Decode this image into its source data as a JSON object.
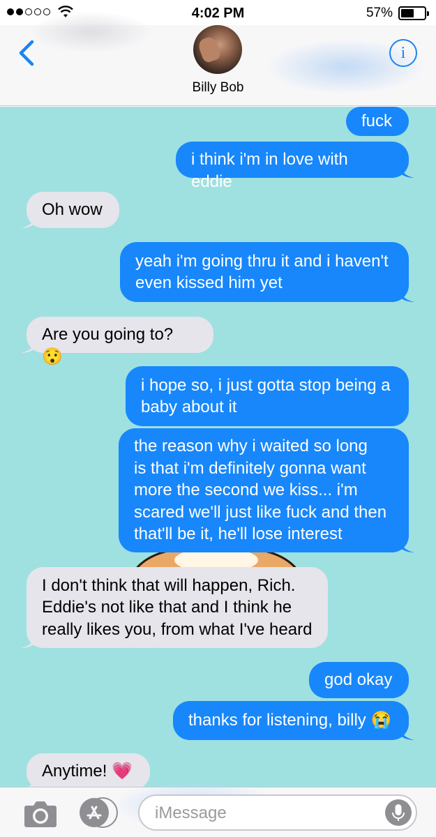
{
  "status_bar": {
    "time": "4:02 PM",
    "battery_percent_label": "57%",
    "battery_level": 0.57,
    "signal_bars_filled": 2,
    "signal_bars_total": 5
  },
  "header": {
    "contact_name": "Billy Bob",
    "info_label": "i"
  },
  "messages": [
    {
      "direction": "out",
      "text": "fuck"
    },
    {
      "direction": "out",
      "text": "i think i'm in love with eddie"
    },
    {
      "direction": "in",
      "text": "Oh wow"
    },
    {
      "direction": "out",
      "text": "yeah i'm going thru it and i haven't\neven kissed him yet"
    },
    {
      "direction": "in",
      "text": "Are you going to? 😯"
    },
    {
      "direction": "out",
      "text": "i hope so, i just gotta stop being a\nbaby about it"
    },
    {
      "direction": "out",
      "text": "the reason why i waited so long\nis that i'm definitely gonna want\nmore the second we kiss... i'm\nscared we'll just like fuck and then\nthat'll be it, he'll lose interest"
    },
    {
      "direction": "in",
      "text": "I don't think that will happen, Rich.\nEddie's not like that and I think he\nreally likes you, from what I've heard"
    },
    {
      "direction": "out",
      "text": "god okay"
    },
    {
      "direction": "out",
      "text": "thanks for listening, billy 😭"
    },
    {
      "direction": "in",
      "text": "Anytime! 💗"
    }
  ],
  "input_bar": {
    "placeholder": "iMessage"
  },
  "colors": {
    "outgoing_bubble": "#1787fb",
    "incoming_bubble": "#e6e5eb",
    "chat_background": "#9fe1e1",
    "accent": "#1a84f0"
  },
  "icons": {
    "back": "chevron-left-icon",
    "info": "info-icon",
    "camera": "camera-icon",
    "apps": "app-store-icon",
    "mic": "microphone-icon"
  }
}
